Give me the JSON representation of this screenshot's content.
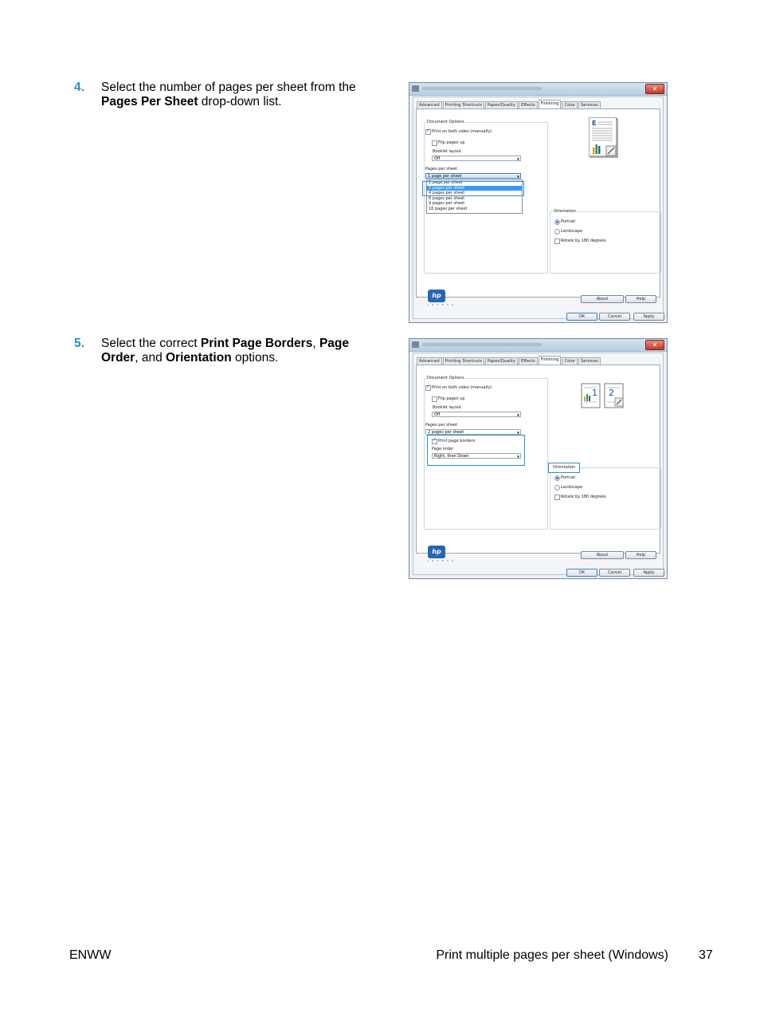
{
  "steps": [
    {
      "num": "4.",
      "pre": "Select the number of pages per sheet from the ",
      "bold1": "Pages Per Sheet",
      "post": " drop-down list."
    },
    {
      "num": "5.",
      "pre": "Select the correct ",
      "bold1": "Print Page Borders",
      "mid1": ", ",
      "bold2": "Page Order",
      "mid2": ", and ",
      "bold3": "Orientation",
      "post": " options."
    }
  ],
  "dialog": {
    "tabs": [
      "Advanced",
      "Printing Shortcuts",
      "Paper/Quality",
      "Effects",
      "Finishing",
      "Color",
      "Services"
    ],
    "active_tab": "Finishing",
    "document_options": "Document Options",
    "print_both_sides": "Print on both sides (manually)",
    "flip_pages_up": "Flip pages up",
    "booklet_layout": "Booklet layout",
    "booklet_value": "Off",
    "pages_per_sheet": "Pages per sheet",
    "orientation": "Orientation",
    "portrait": "Portrait",
    "landscape": "Landscape",
    "rotate": "Rotate by 180 degrees",
    "about": "About",
    "help": "Help",
    "ok": "OK",
    "cancel": "Cancel",
    "apply": "Apply",
    "invent": "i n v e n t",
    "close_glyph": "✕"
  },
  "dialog1": {
    "pps_value": "1 page per sheet",
    "dropdown": [
      "1 page per sheet",
      "2 pages per sheet",
      "4 pages per sheet",
      "6 pages per sheet",
      "9 pages per sheet",
      "16 pages per sheet"
    ],
    "selected_index": 1
  },
  "dialog2": {
    "pps_value": "2 pages per sheet",
    "print_page_borders": "Print page borders",
    "page_order": "Page order",
    "page_order_value": "Right, then Down",
    "preview_nums": [
      "1",
      "2"
    ]
  },
  "footer": {
    "left": "ENWW",
    "right": "Print multiple pages per sheet (Windows)",
    "page": "37"
  }
}
